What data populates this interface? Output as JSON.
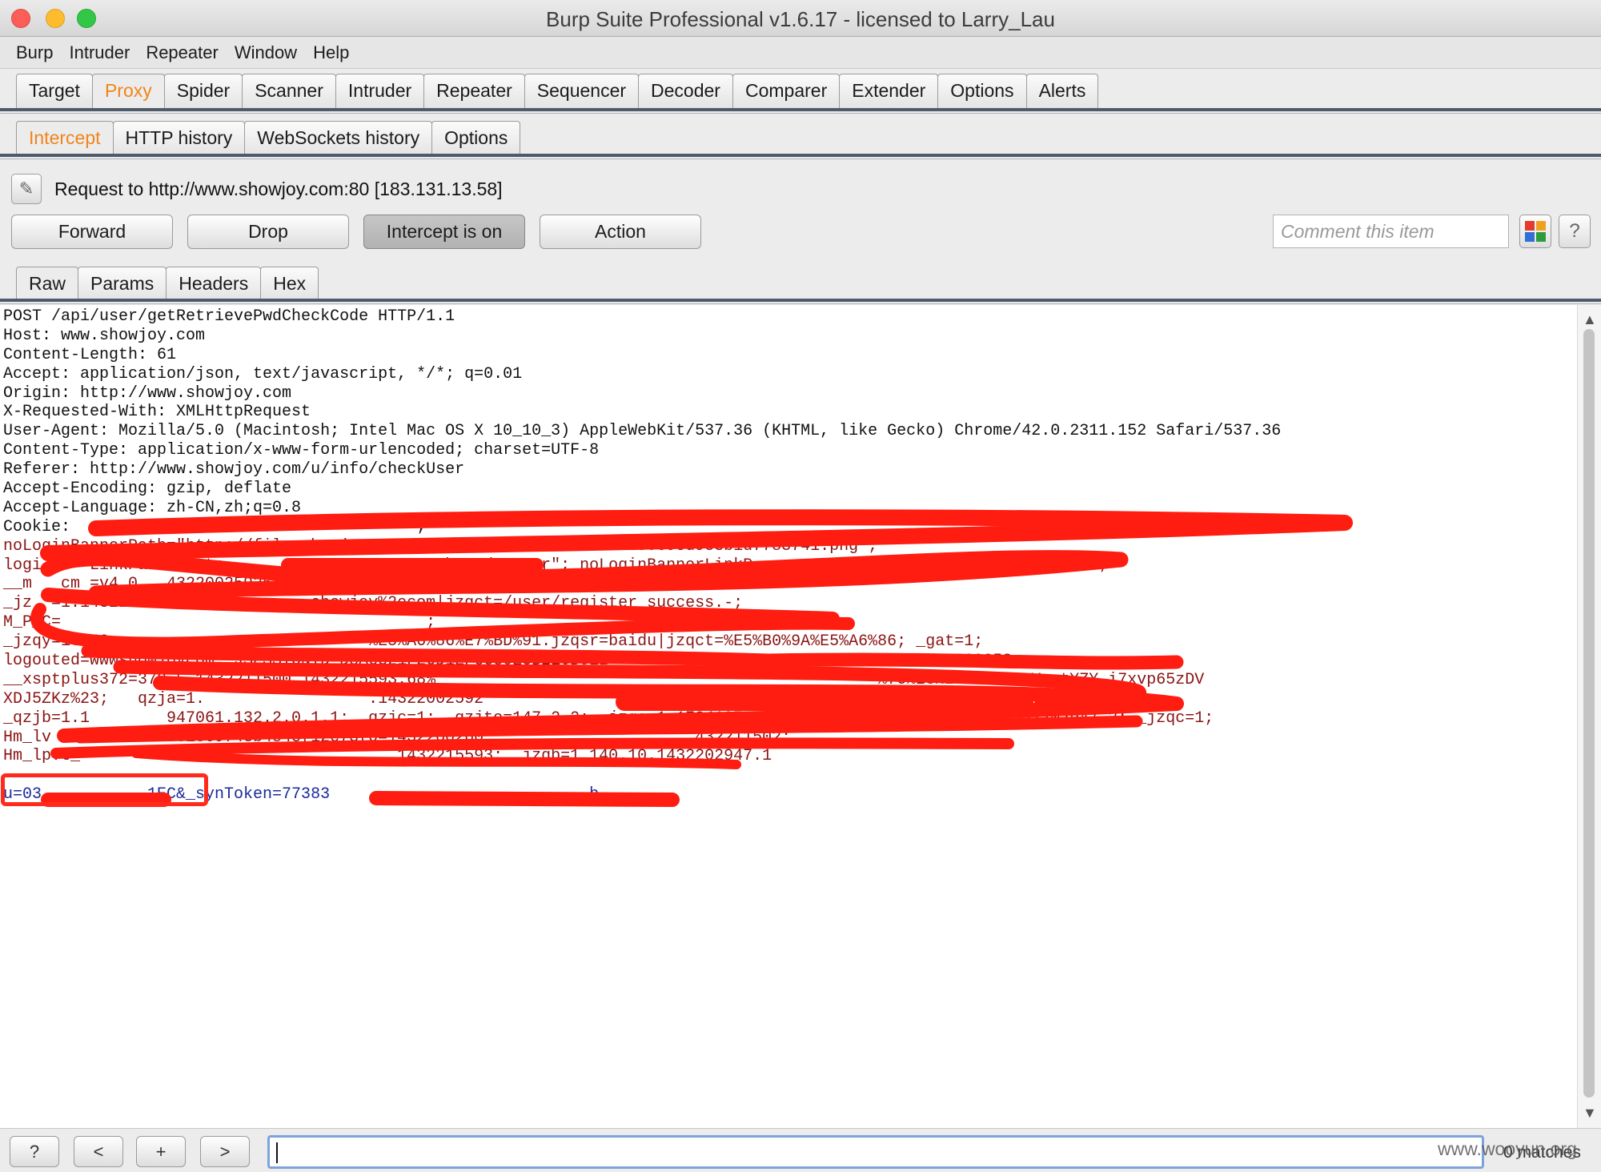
{
  "window": {
    "title": "Burp Suite Professional v1.6.17 - licensed to Larry_Lau"
  },
  "menubar": [
    "Burp",
    "Intruder",
    "Repeater",
    "Window",
    "Help"
  ],
  "main_tabs": [
    "Target",
    "Proxy",
    "Spider",
    "Scanner",
    "Intruder",
    "Repeater",
    "Sequencer",
    "Decoder",
    "Comparer",
    "Extender",
    "Options",
    "Alerts"
  ],
  "main_tab_active": "Proxy",
  "sub_tabs": [
    "Intercept",
    "HTTP history",
    "WebSockets history",
    "Options"
  ],
  "sub_tab_active": "Intercept",
  "request": {
    "label": "Request to http://www.showjoy.com:80  [183.131.13.58]",
    "edit_icon": "pencil-icon"
  },
  "buttons": {
    "forward": "Forward",
    "drop": "Drop",
    "intercept": "Intercept is on",
    "action": "Action"
  },
  "comment": {
    "placeholder": "Comment this item"
  },
  "view_tabs": [
    "Raw",
    "Params",
    "Headers",
    "Hex"
  ],
  "view_tab_active": "Raw",
  "raw_lines": [
    {
      "text": "POST /api/user/getRetrievePwdCheckCode HTTP/1.1",
      "color": "black"
    },
    {
      "text": "Host: www.showjoy.com",
      "color": "black"
    },
    {
      "text": "Content-Length: 61",
      "color": "black"
    },
    {
      "text": "Accept: application/json, text/javascript, */*; q=0.01",
      "color": "black"
    },
    {
      "text": "Origin: http://www.showjoy.com",
      "color": "black"
    },
    {
      "text": "X-Requested-With: XMLHttpRequest",
      "color": "black"
    },
    {
      "text": "User-Agent: Mozilla/5.0 (Macintosh; Intel Mac OS X 10_10_3) AppleWebKit/537.36 (KHTML, like Gecko) Chrome/42.0.2311.152 Safari/537.36",
      "color": "black"
    },
    {
      "text": "Content-Type: application/x-www-form-urlencoded; charset=UTF-8",
      "color": "black"
    },
    {
      "text": "Referer: http://www.showjoy.com/u/info/checkUser",
      "color": "black"
    },
    {
      "text": "Accept-Encoding: gzip, deflate",
      "color": "black"
    },
    {
      "text": "Accept-Language: zh-CN,zh;q=0.8",
      "color": "black"
    },
    {
      "text": "Cookie:                                    ;",
      "color": "black"
    },
    {
      "text": "noLoginBannerPath=\"http://file.showjoy.com/images/19/1900ab8eba4149569cd9c3b1d7783741.png\";",
      "color": "dark-red"
    },
    {
      "text": "logi     LinkPath=\"http                       broadcaster\"; noLoginBannerLinkP                 y/topic/18659.html\";",
      "color": "dark-red"
    },
    {
      "text": "__m   cm =v4.0   432200259254;   jzqckmp=1;",
      "color": "dark-red"
    },
    {
      "text": "_jz  =1.143220294               showjoy%2ecom|jzqct=/user/register_success.-;",
      "color": "dark-red"
    },
    {
      "text": "M_P_C=                                      ;",
      "color": "dark-red"
    },
    {
      "text": "_jzqy=1.143                           %E5%A6%86%E7%BD%91.jzqsr=baidu|jzqct=%E5%B0%9A%E5%A6%86; _gat=1;",
      "color": "dark-red"
    },
    {
      "text": "logouted=wwwshowjoycom; JSESSIONID=D8A6321F26D1EFCC30E3B216B8E2                                 432200258;",
      "color": "dark-red"
    },
    {
      "text": "__xsptplus372=372.5.1432211500.1432215593.68%                                              %7C%23%23SZKYmZ_YvotYZY_i7xvp65zDV",
      "color": "dark-red"
    },
    {
      "text": "XDJ5ZKz%23;   qzja=1.                 .14322002592                                593132.     ih7.1.2.147.2;",
      "color": "dark-red"
    },
    {
      "text": "_qzjb=1.1        947061.132.2.0.1.1; _qzjc=1; _qzjto=147.2.2; _jzqa=1.17341979              .1432200259.1432202947.2; _jzqc=1;",
      "color": "dark-red"
    },
    {
      "text": "Hm_lv    909ad7e1861369743b4843f12c73f0=1432200260                      432211502;",
      "color": "dark-red"
    },
    {
      "text": "Hm_lpvt_                                 1432215593; _jzqb=1.140.10.1432202947.1",
      "color": "dark-red"
    },
    {
      "text": "",
      "color": "black"
    },
    {
      "text": "u=03           1EC&_synToken=77383                           b",
      "color": "blue"
    }
  ],
  "bottom": {
    "help": "?",
    "prev": "<",
    "add": "+",
    "next": ">",
    "matches": "0 matches",
    "watermark": "www.wooyun.org"
  }
}
